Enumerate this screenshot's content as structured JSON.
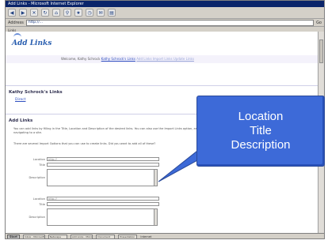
{
  "window": {
    "title": "Add Links - Microsoft Internet Explorer"
  },
  "toolbar": {
    "icons": [
      "back-icon",
      "forward-icon",
      "stop-icon",
      "refresh-icon",
      "home-icon",
      "search-icon",
      "favorites-icon",
      "history-icon",
      "mail-icon",
      "print-icon"
    ]
  },
  "address": {
    "label": "Address",
    "url": "http://...",
    "go_label": "Go"
  },
  "links_bar": {
    "label": "Links"
  },
  "page": {
    "logo_text": "Add Links",
    "header_text": "Welcome, Kathy Schrock",
    "header_link": "Kathy Schrock's Links",
    "header_link2": "Add Links Import Links Update Links",
    "section1_title": "Kathy Schrock's Links",
    "section1_link": "Direct",
    "section2_title": "Add Links",
    "para1": "You can add links by filling in the Title, Location and Description of the desired links. You can also use the Import Links option, and you can also add new links by navigating to a site.",
    "para2": "There are several Import Options that you can use to create links. Did you want to add all of these?",
    "form1": {
      "location_label": "Location",
      "location_value": "http://",
      "title_label": "Title",
      "description_label": "Description"
    },
    "form2": {
      "location_label": "Location",
      "location_value": "http://",
      "title_label": "Title",
      "description_label": "Description"
    }
  },
  "callout": {
    "line1": "Location",
    "line2": "Title",
    "line3": "Description"
  },
  "statusbar": {
    "start_label": "Start",
    "status_text": "Internet",
    "tasks": [
      "Inbox - Microsoft",
      "Netscape",
      "Add Links - Micro",
      "Document",
      "Presentation"
    ]
  },
  "colors": {
    "callout": "#3d6ad8",
    "link": "#3050c0",
    "logo": "#2a5fb0"
  }
}
